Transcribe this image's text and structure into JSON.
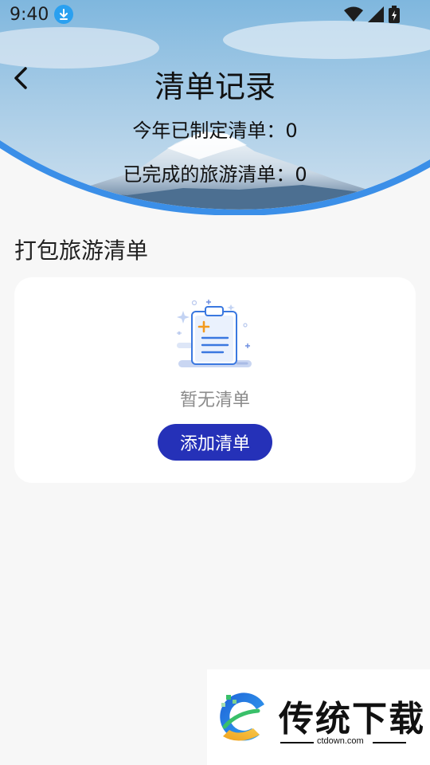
{
  "status_bar": {
    "time": "9:40"
  },
  "header": {
    "title": "清单记录",
    "stats": [
      "今年已制定清单：0",
      "已完成的旅游清单：0"
    ]
  },
  "section": {
    "title": "打包旅游清单"
  },
  "card": {
    "empty_text": "暂无清单",
    "add_button": "添加清单"
  },
  "watermark": {
    "title": "传统下载",
    "url": "ctdown.com"
  },
  "colors": {
    "accent": "#2531b8",
    "sky_blue": "#3b8fe8",
    "background": "#f7f7f7"
  },
  "icons": {
    "back": "chevron-left-icon",
    "download": "download-icon",
    "wifi": "wifi-icon",
    "signal": "signal-icon",
    "battery": "battery-icon",
    "empty": "clipboard-icon"
  }
}
